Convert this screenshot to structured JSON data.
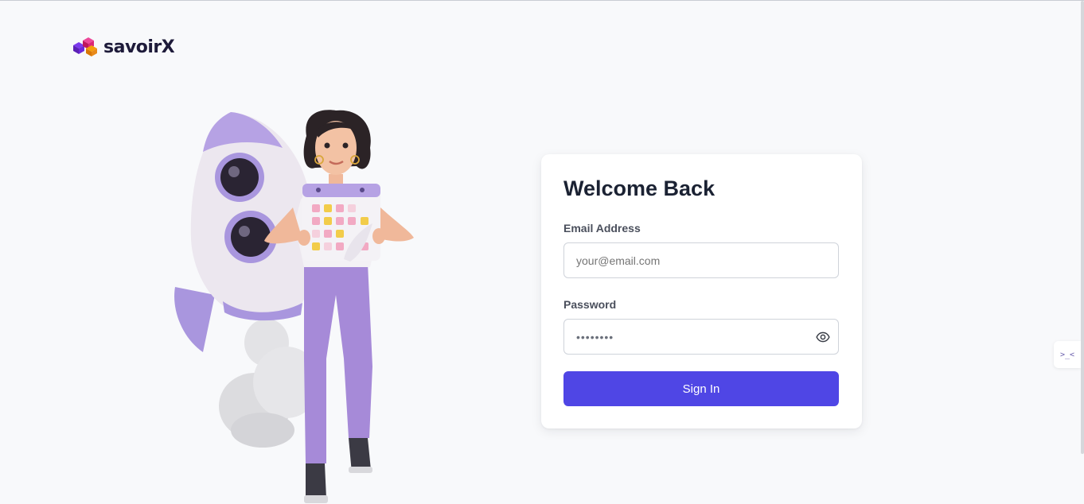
{
  "brand": {
    "name": "savoirX",
    "logo_icon": "cube-cluster-icon"
  },
  "login": {
    "title": "Welcome Back",
    "email_label": "Email Address",
    "email_placeholder": "your@email.com",
    "email_value": "",
    "password_label": "Password",
    "password_value": "••••••••",
    "password_toggle_icon": "eye-icon",
    "submit_label": "Sign In"
  },
  "side_widget": {
    "icon": "code-chevrons-icon",
    "glyph": ">_<"
  },
  "colors": {
    "accent": "#4f46e5",
    "background": "#f8f9fb",
    "card": "#ffffff",
    "illustration_purple": "#a996de"
  }
}
